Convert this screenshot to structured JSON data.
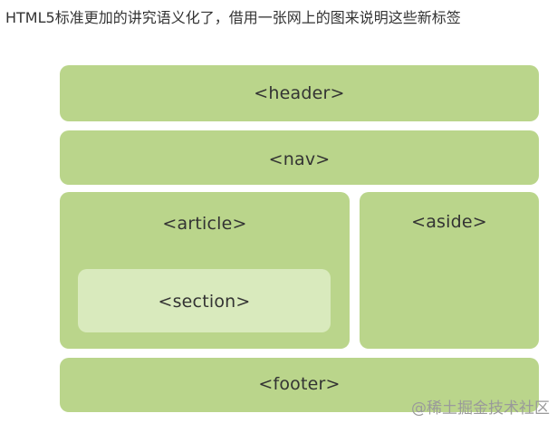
{
  "caption": "HTML5标准更加的讲究语义化了，借用一张网上的图来说明这些新标签",
  "diagram": {
    "header": "<header>",
    "nav": "<nav>",
    "article": "<article>",
    "section": "<section>",
    "aside": "<aside>",
    "footer": "<footer>"
  },
  "watermark": "@稀土掘金技术社区",
  "colors": {
    "block": "#bad58b",
    "section_block": "#d9eabd",
    "text": "#333333"
  }
}
